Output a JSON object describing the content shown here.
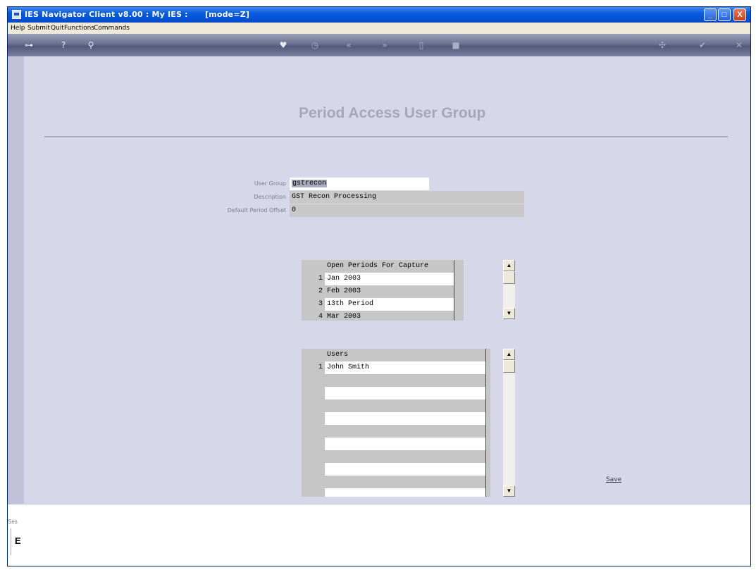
{
  "window": {
    "title": "IES Navigator Client v8.00 : My IES :      [mode=Z]",
    "min_glyph": "_",
    "max_glyph": "□",
    "close_glyph": "X"
  },
  "menu": [
    "Help",
    "Submit",
    "Quit",
    "Functions",
    "Commands"
  ],
  "toolbar": {
    "icons": [
      "key-icon",
      "help-icon",
      "search-icon",
      "heart-icon",
      "clock-icon",
      "rewind-icon",
      "forward-icon",
      "page-icon",
      "square-icon",
      "settings-icon",
      "check-icon",
      "close-icon"
    ],
    "glyphs": [
      "⊶",
      "?",
      "⚲",
      "♥",
      "◷",
      "«",
      "»",
      "▯",
      "■",
      "✣",
      "✔",
      "✕"
    ]
  },
  "page": {
    "title": "Period Access User Group"
  },
  "form": {
    "user_group_label": "User Group",
    "user_group_value": "gstrecon",
    "description_label": "Description",
    "description_value": "GST Recon Processing",
    "offset_label": "Default Period Offset",
    "offset_value": "0"
  },
  "periods_grid": {
    "header": "Open Periods For Capture",
    "rows": [
      {
        "num": "1",
        "value": "Jan 2003"
      },
      {
        "num": "2",
        "value": "Feb 2003"
      },
      {
        "num": "3",
        "value": "13th Period"
      },
      {
        "num": "4",
        "value": "Mar 2003"
      }
    ]
  },
  "users_grid": {
    "header": "Users",
    "rows": [
      {
        "num": "1",
        "value": "John Smith"
      }
    ]
  },
  "scroll": {
    "up": "▲",
    "down": "▼"
  },
  "actions": {
    "save": "Save"
  },
  "status": {
    "session_label": "Ses",
    "session_value": "E"
  }
}
